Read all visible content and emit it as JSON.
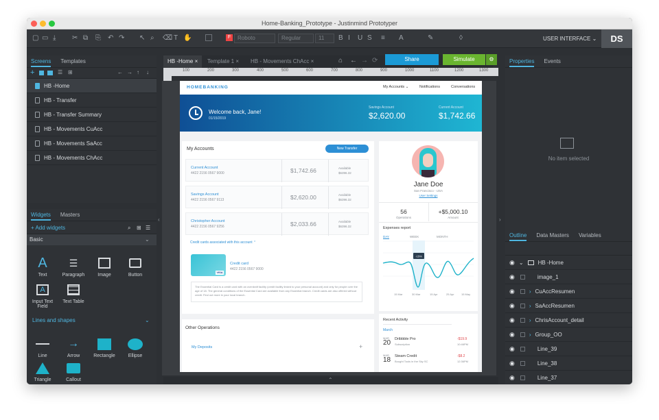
{
  "window": {
    "title": "Home-Banking_Prototype - Justinmind Prototyper"
  },
  "toolbar": {
    "font": "Roboto",
    "weight": "Regular",
    "size": "11",
    "mode": "USER INTERFACE",
    "avatar": "DS"
  },
  "screens": {
    "tabs": [
      "Screens",
      "Templates"
    ],
    "items": [
      "HB -Home",
      "HB - Transfer",
      "HB - Transfer Summary",
      "HB - Movements CuAcc",
      "HB - Movements SaAcc",
      "HB - Movements ChAcc"
    ]
  },
  "widgets": {
    "tabs": [
      "Widgets",
      "Masters"
    ],
    "add": "+ Add widgets",
    "group1": "Basic",
    "group2": "Lines and shapes",
    "basic": [
      "Text",
      "Paragraph",
      "Image",
      "Button",
      "Input Text Field",
      "Text Table"
    ],
    "shapes": [
      "Line",
      "Arrow",
      "Rectangle",
      "Ellipse",
      "Triangle",
      "Callout"
    ]
  },
  "doctabs": [
    "HB -Home",
    "Template 1",
    "HB - Movements ChAcc"
  ],
  "share": "Share",
  "simulate": "Simulate",
  "properties": {
    "tabs": [
      "Properties",
      "Events"
    ],
    "empty": "No item selected"
  },
  "outline": {
    "tabs": [
      "Outline",
      "Data Masters",
      "Variables"
    ],
    "items": [
      "HB -Home",
      "image_1",
      "CuAccResumen",
      "SaAccResumen",
      "ChrisAccount_detail",
      "Group_OO",
      "Line_39",
      "Line_38",
      "Line_37"
    ]
  },
  "ruler": [
    "100",
    "200",
    "300",
    "400",
    "500",
    "600",
    "700",
    "800",
    "900",
    "1000",
    "1100",
    "1200",
    "1300"
  ],
  "vruler": [
    "100",
    "200",
    "300",
    "400",
    "500",
    "600",
    "700",
    "800",
    "900",
    "1000"
  ],
  "app": {
    "logo": "HOMEBANKING",
    "nav": [
      "My Accounts",
      "Notifications",
      "Conversations"
    ],
    "welcome": "Welcome back, Jane!",
    "date": "01/15/2019",
    "savings_label": "Savings Account",
    "savings": "$2,620.00",
    "current_label": "Current Account",
    "current": "$1,742.66",
    "my_accounts": "My Accounts",
    "new_transfer": "New Transfer",
    "accounts": [
      {
        "name": "Current Account",
        "num": "4422 2156 0567 9000",
        "bal": "$1,742.66",
        "avail": "Available",
        "avail_val": "$6396.32"
      },
      {
        "name": "Savings Account",
        "num": "4422 2156 0567 9113",
        "bal": "$2,620.00",
        "avail": "Available",
        "avail_val": "$6396.32"
      },
      {
        "name": "Christopher Account",
        "num": "4422 2156 0567 9256",
        "bal": "$2,033.66",
        "avail": "Available",
        "avail_val": "$6396.32"
      }
    ],
    "cc_assoc": "Credit cards associated with this account",
    "cc_name": "Credit card",
    "cc_num": "4422 2156 0567 9000",
    "cc_text": "The Essential Card is a credit card with an overdraft facility (credit facility linked to your personal account) and only for people over the age of 18. The general conditions of the Essential Card are available from any Essential branch. Credit cards are also offered without credit. Find out more in your local branch.",
    "other_ops": "Other Operations",
    "my_deposits": "My Deposits",
    "plus": "+",
    "profile_name": "Jane Doe",
    "profile_loc": "San Francisco - USA",
    "profile_link": "User Settings",
    "ops_val": "56",
    "ops_label": "Operations",
    "amount_val": "+$5,000.10",
    "amount_label": "Amount",
    "expenses": "Expenses report",
    "periods": [
      "DAY",
      "WEEK",
      "MONTH"
    ],
    "tooltip": "-15%",
    "xticks": [
      "15 Mar",
      "30 Mar",
      "15 Apr",
      "25 Apr",
      "15 May"
    ],
    "recent": "Recent Activity",
    "month": "March",
    "tx": [
      {
        "m": "MAR",
        "d": "20",
        "name": "Dribbble Pro",
        "sub": "Subscription",
        "amt": "-$19.9",
        "time": "10:46PM"
      },
      {
        "m": "MAR",
        "d": "18",
        "name": "Steam Credit",
        "sub": "Bought Tools in the Sky SC",
        "amt": "-$8.2",
        "time": "12:36PM"
      }
    ]
  },
  "colors": {
    "accent": "#2d8fd5",
    "share": "#1b9ad6",
    "simulate": "#6ab530",
    "banner_from": "#0f4f95",
    "banner_to": "#1fb6d3"
  }
}
